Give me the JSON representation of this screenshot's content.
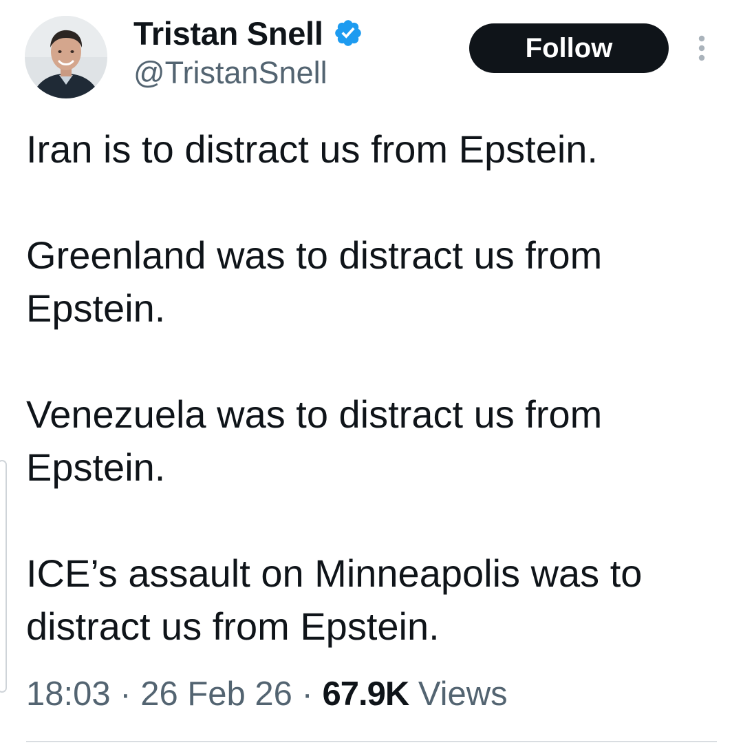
{
  "author": {
    "display_name": "Tristan Snell",
    "handle": "@TristanSnell",
    "verified": true,
    "verified_color": "#1d9bf0"
  },
  "actions": {
    "follow_label": "Follow",
    "more_icon": "more-vertical-icon"
  },
  "tweet": {
    "paragraphs": [
      "Iran is to distract us from Epstein.",
      "Greenland was to distract us from Epstein.",
      "Venezuela was to distract us from Epstein.",
      "ICE’s assault on Minneapolis was to distract us from Epstein."
    ]
  },
  "meta": {
    "time": "18:03",
    "separator": "·",
    "date": "26 Feb 26",
    "views_count": "67.9K",
    "views_label": "Views"
  },
  "colors": {
    "text_primary": "#0f1419",
    "text_secondary": "#536471",
    "button_bg": "#0f1419",
    "button_text": "#ffffff"
  }
}
